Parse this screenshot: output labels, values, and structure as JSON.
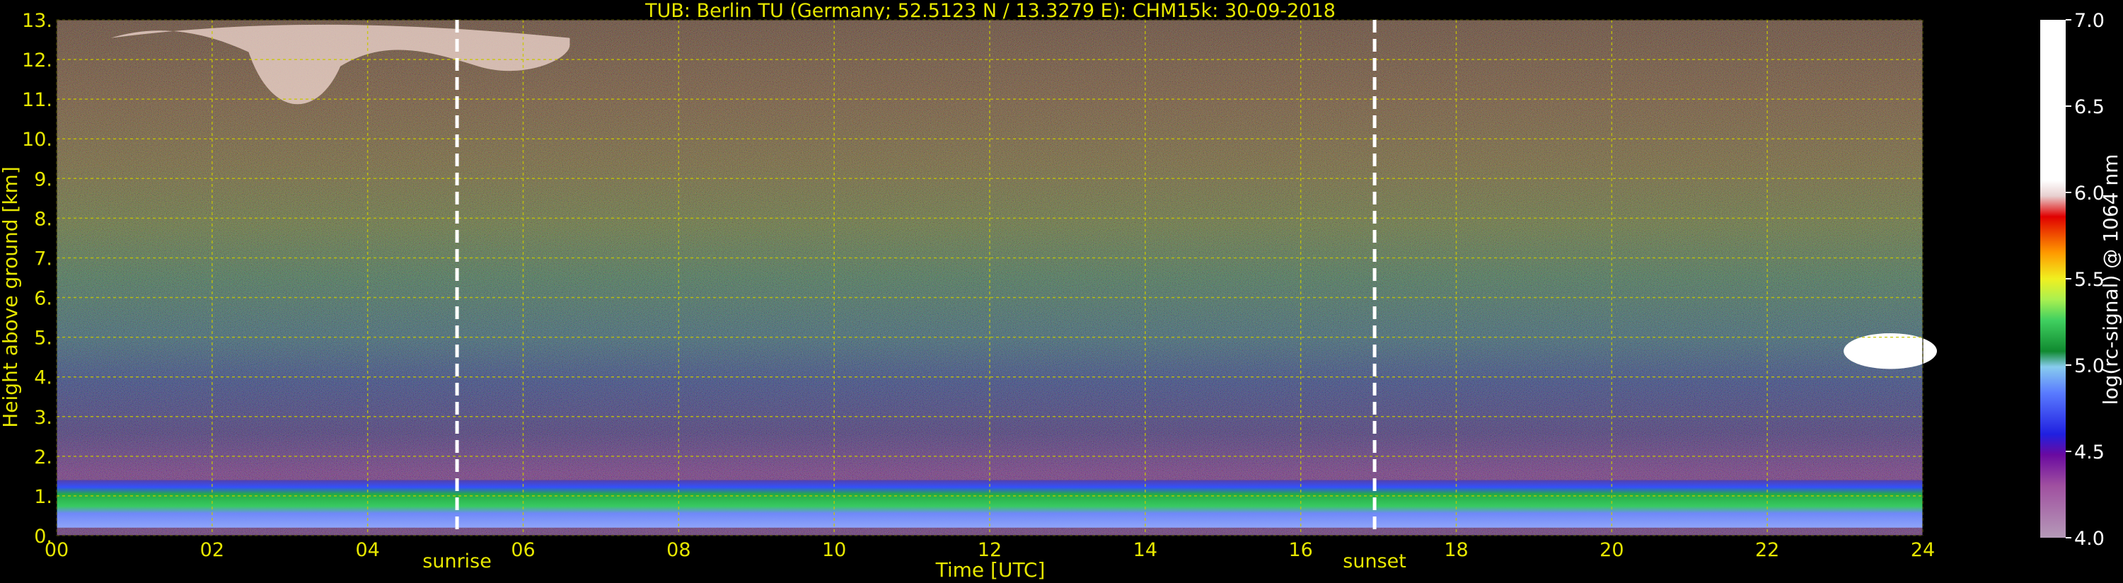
{
  "chart_data": {
    "type": "heatmap",
    "title": "TUB: Berlin TU (Germany; 52.5123 N / 13.3279 E):    CHM15k: 30-09-2018",
    "xlabel": "Time [UTC]",
    "ylabel": "Height above ground [km]",
    "xlim": [
      0,
      24
    ],
    "ylim": [
      0,
      13
    ],
    "x_ticks": [
      0,
      2,
      4,
      6,
      8,
      10,
      12,
      14,
      16,
      18,
      20,
      22,
      24
    ],
    "x_tick_labels": [
      "00",
      "02",
      "04",
      "06",
      "08",
      "10",
      "12",
      "14",
      "16",
      "18",
      "20",
      "22",
      "24"
    ],
    "y_ticks": [
      0,
      1,
      2,
      3,
      4,
      5,
      6,
      7,
      8,
      9,
      10,
      11,
      12,
      13
    ],
    "y_tick_labels": [
      "0.",
      "1.",
      "2.",
      "3.",
      "4.",
      "5.",
      "6.",
      "7.",
      "8.",
      "9.",
      "10.",
      "11.",
      "12.",
      "13."
    ],
    "grid": true,
    "colorbar": {
      "label": "log(rc-signal) @ 1064 nm",
      "range": [
        4.0,
        7.0
      ],
      "ticks": [
        4.0,
        4.5,
        5.0,
        5.5,
        6.0,
        6.5,
        7.0
      ],
      "tick_labels": [
        "4.0",
        "4.5",
        "5.0",
        "5.5",
        "6.0",
        "6.5",
        "7.0"
      ]
    },
    "annotations": [
      {
        "text": "sunrise",
        "x": 5.15
      },
      {
        "text": "sunset",
        "x": 16.95
      }
    ],
    "layers": [
      {
        "feature": "boundary layer aerosol",
        "height_km": [
          0.2,
          1.4
        ],
        "value_range": [
          4.9,
          5.2
        ]
      },
      {
        "feature": "high cirrus cloud",
        "time_range": [
          0.7,
          6.6
        ],
        "height_km": [
          10.5,
          12.9
        ],
        "value_range": [
          6.0,
          7.0
        ]
      },
      {
        "feature": "mid-level cloud",
        "time_range": [
          22.8,
          24.0
        ],
        "height_km": [
          4.2,
          5.1
        ],
        "value_range": [
          6.5,
          7.0
        ]
      }
    ]
  },
  "colors": {
    "background": "#000000",
    "axis_text": "#e6e600",
    "grid": "#c8c800",
    "marker_line": "#ffffff"
  }
}
